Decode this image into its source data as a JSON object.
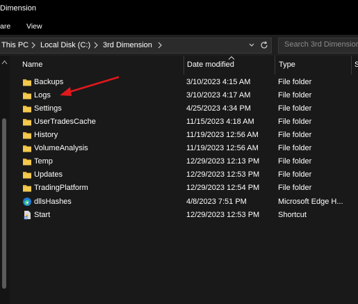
{
  "window": {
    "title": "Dimension"
  },
  "menu": {
    "share": "are",
    "view": "View"
  },
  "address": {
    "crumbs": [
      "This PC",
      "Local Disk (C:)",
      "3rd Dimension"
    ]
  },
  "search": {
    "placeholder": "Search 3rd Dimension"
  },
  "columns": {
    "name": "Name",
    "date": "Date modified",
    "type": "Type",
    "size": "S"
  },
  "files": [
    {
      "name": "Backups",
      "date": "3/10/2023 4:15 AM",
      "type": "File folder",
      "icon": "folder-icon"
    },
    {
      "name": "Logs",
      "date": "3/10/2023 4:17 AM",
      "type": "File folder",
      "icon": "folder-icon"
    },
    {
      "name": "Settings",
      "date": "4/25/2023 4:34 PM",
      "type": "File folder",
      "icon": "folder-icon"
    },
    {
      "name": "UserTradesCache",
      "date": "11/15/2023 4:18 AM",
      "type": "File folder",
      "icon": "folder-icon"
    },
    {
      "name": "History",
      "date": "11/19/2023 12:56 AM",
      "type": "File folder",
      "icon": "folder-icon"
    },
    {
      "name": "VolumeAnalysis",
      "date": "11/19/2023 12:56 AM",
      "type": "File folder",
      "icon": "folder-icon"
    },
    {
      "name": "Temp",
      "date": "12/29/2023 12:13 PM",
      "type": "File folder",
      "icon": "folder-icon"
    },
    {
      "name": "Updates",
      "date": "12/29/2023 12:53 PM",
      "type": "File folder",
      "icon": "folder-icon"
    },
    {
      "name": "TradingPlatform",
      "date": "12/29/2023 12:54 PM",
      "type": "File folder",
      "icon": "folder-icon"
    },
    {
      "name": "dllsHashes",
      "date": "4/8/2023 7:51 PM",
      "type": "Microsoft Edge H...",
      "icon": "edge-icon"
    },
    {
      "name": "Start",
      "date": "12/29/2023 12:53 PM",
      "type": "Shortcut",
      "icon": "shortcut-icon"
    }
  ],
  "colors": {
    "folder": "#f3c94f",
    "arrow": "#e0191d",
    "background": "#191919"
  }
}
